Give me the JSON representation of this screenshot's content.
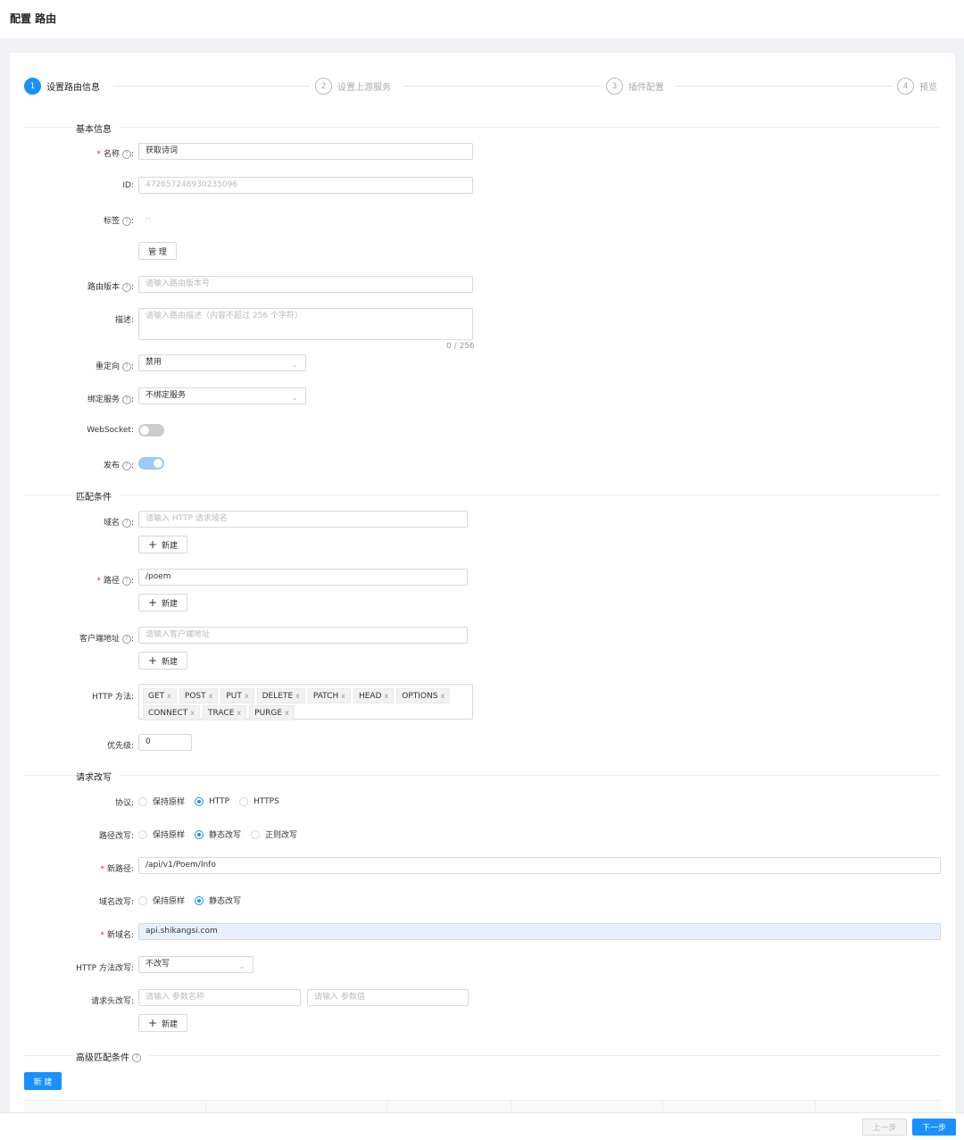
{
  "page_title": "配置 路由",
  "steps": [
    {
      "num": "1",
      "label": "设置路由信息"
    },
    {
      "num": "2",
      "label": "设置上游服务"
    },
    {
      "num": "3",
      "label": "插件配置"
    },
    {
      "num": "4",
      "label": "预览"
    }
  ],
  "sections": {
    "basic": "基本信息",
    "match": "匹配条件",
    "rewrite": "请求改写",
    "advanced": "高级匹配条件"
  },
  "basic": {
    "name_label": "名称",
    "name_value": "获取诗词",
    "id_label": "ID:",
    "id_value": "472657248930235096",
    "labels_label": "标签",
    "labels_value": "--",
    "manage_button": "管 理",
    "version_label": "路由版本",
    "version_placeholder": "请输入路由版本号",
    "desc_label": "描述:",
    "desc_placeholder": "请输入路由描述（内容不超过 256 个字符）",
    "desc_counter": "0 / 256",
    "redirect_label": "重定向",
    "redirect_value": "禁用",
    "bind_service_label": "绑定服务",
    "bind_service_value": "不绑定服务",
    "websocket_label": "WebSocket:",
    "publish_label": "发布"
  },
  "match": {
    "host_label": "域名",
    "host_placeholder": "请输入 HTTP 请求域名",
    "path_label": "路径",
    "path_value": "/poem",
    "client_label": "客户端地址",
    "client_placeholder": "请输入客户端地址",
    "add_label": "新建",
    "methods_label": "HTTP 方法:",
    "methods": [
      "GET",
      "POST",
      "PUT",
      "DELETE",
      "PATCH",
      "HEAD",
      "OPTIONS",
      "CONNECT",
      "TRACE",
      "PURGE"
    ],
    "tag_close": "x",
    "priority_label": "优先级:",
    "priority_value": "0"
  },
  "rewrite": {
    "protocol_label": "协议:",
    "protocol_options": [
      "保持原样",
      "HTTP",
      "HTTPS"
    ],
    "protocol_selected": "HTTP",
    "path_rewrite_label": "路径改写:",
    "path_rewrite_options": [
      "保持原样",
      "静态改写",
      "正则改写"
    ],
    "path_rewrite_selected": "静态改写",
    "new_path_label": "新路径:",
    "new_path_value": "/api/v1/Poem/Info",
    "host_rewrite_label": "域名改写:",
    "host_rewrite_options": [
      "保持原样",
      "静态改写"
    ],
    "host_rewrite_selected": "静态改写",
    "new_host_label": "新域名:",
    "new_host_value": "api.shikangsi.com",
    "method_rewrite_label": "HTTP 方法改写:",
    "method_rewrite_value": "不改写",
    "header_rewrite_label": "请求头改写:",
    "header_name_placeholder": "请输入 参数名称",
    "header_value_placeholder": "请输入 参数值",
    "add_label": "新建"
  },
  "advanced": {
    "new_button": "新 建"
  },
  "footer": {
    "prev": "上一步",
    "next": "下一步"
  }
}
